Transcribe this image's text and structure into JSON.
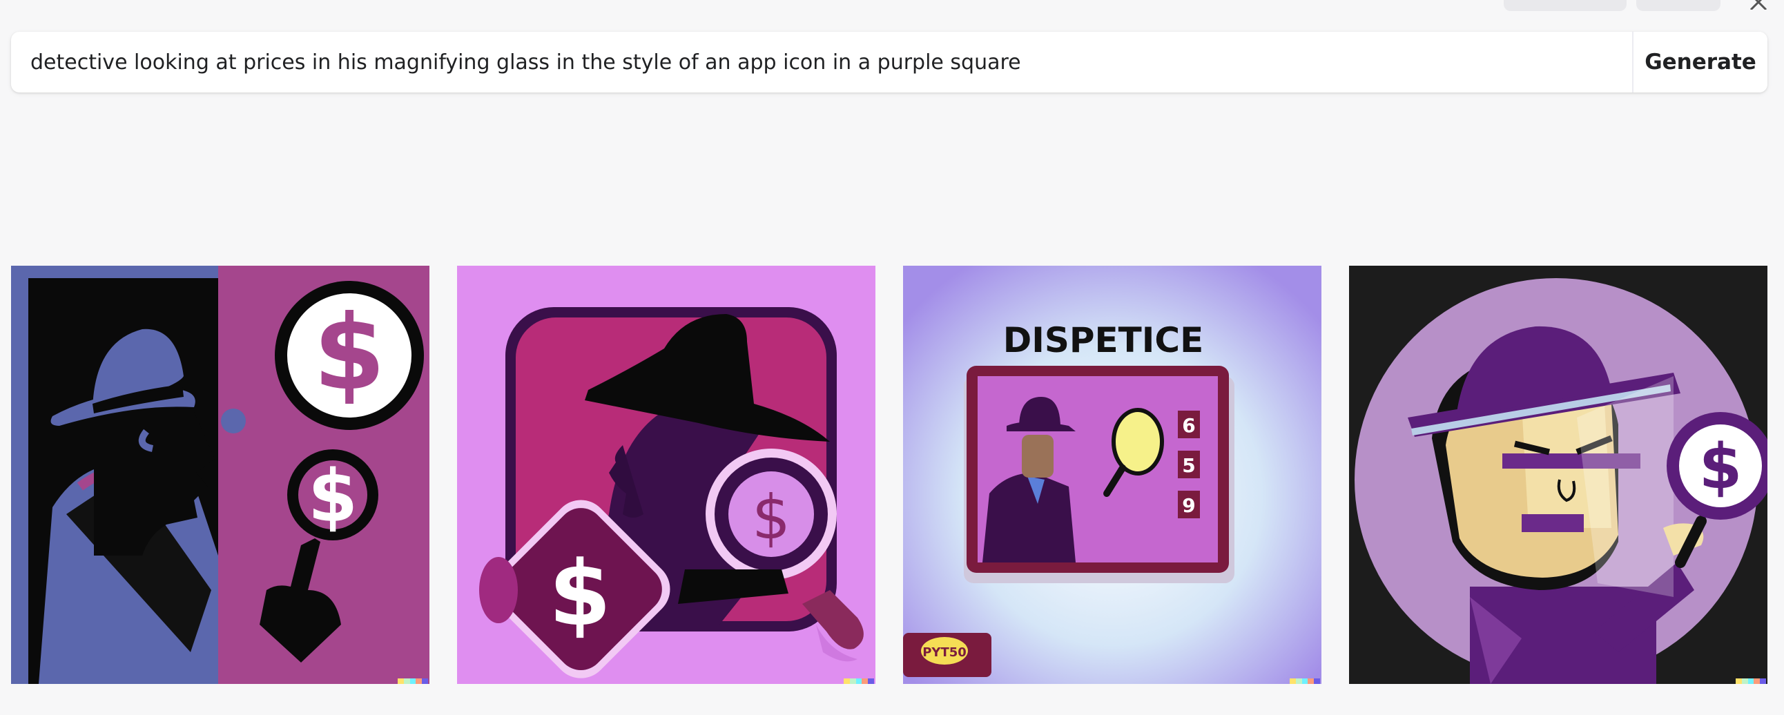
{
  "prompt": {
    "value": "detective looking at prices in his magnifying glass in the style of an app icon in a purple square",
    "generate_label": "Generate"
  },
  "results": [
    {
      "caption": "",
      "dollar": "$",
      "small_dollar": "$"
    },
    {
      "caption": "",
      "dollar": "$",
      "small_dollar": "$"
    },
    {
      "caption": "DISPETICE",
      "digits": [
        "6",
        "5",
        "9"
      ],
      "badge": "ΡΥΤ50"
    },
    {
      "caption": "",
      "dollar": "$"
    }
  ],
  "colors": {
    "accent": "#8e3a8f",
    "signature": [
      "#ffe26a",
      "#bff3c8",
      "#6ff1ff",
      "#fc9b7a",
      "#6b5ce7"
    ]
  }
}
